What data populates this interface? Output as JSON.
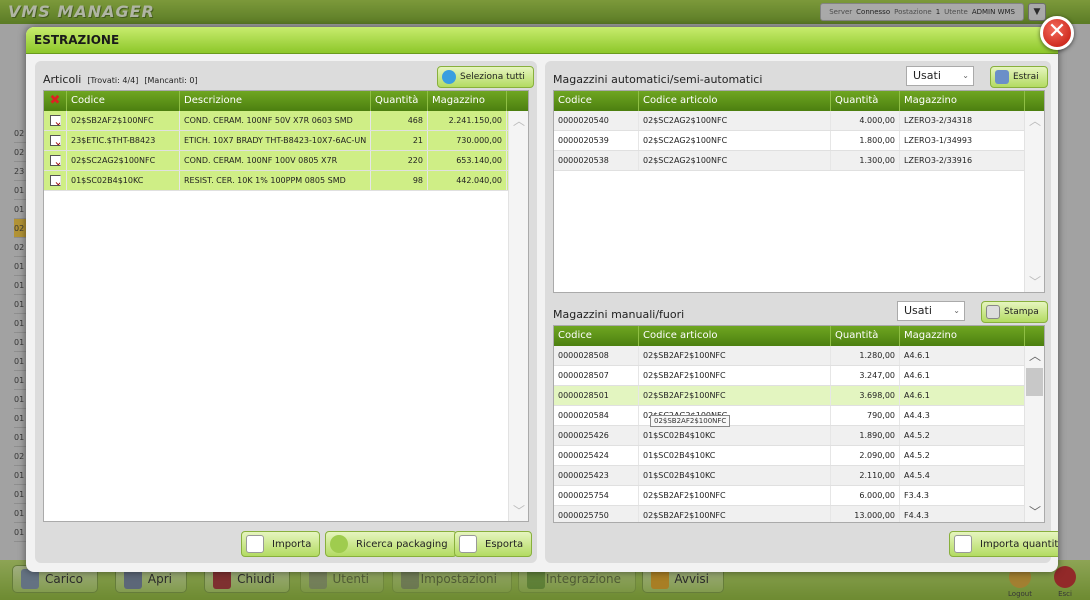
{
  "app": {
    "title": "VMS MANAGER"
  },
  "status": {
    "server_label": "Server",
    "server_value": "Connesso",
    "station_label": "Postazione",
    "station_value": "1",
    "user_label": "Utente",
    "user_value": "ADMIN WMS"
  },
  "background_list": [
    "02",
    "02",
    "23",
    "01",
    "01",
    "02",
    "02",
    "01",
    "01",
    "01",
    "01",
    "01",
    "01",
    "01",
    "01",
    "01",
    "01",
    "02",
    "01",
    "01",
    "01",
    "01"
  ],
  "bottom": {
    "buttons": [
      "Carico",
      "Apri",
      "Chiudi",
      "Utenti",
      "Impostazioni",
      "Integrazione",
      "Avvisi"
    ],
    "logout": "Logout",
    "exit": "Esci"
  },
  "dialog": {
    "title": "ESTRAZIONE",
    "left": {
      "title": "Articoli",
      "found": "[Trovati: 4/4]",
      "missing": "[Mancanti: 0]",
      "select_all": "Seleziona tutti",
      "columns": [
        "Codice",
        "Descrizione",
        "Quantità",
        "Magazzino"
      ],
      "rows": [
        {
          "code": "02$SB2AF2$100NFC",
          "desc": "COND. CERAM. 100NF 50V X7R 0603 SMD",
          "qty": "468",
          "stock": "2.241.150,00"
        },
        {
          "code": "23$ETIC.$THT-B8423",
          "desc": "ETICH. 10X7 BRADY THT-B8423-10X7-6AC-UN",
          "qty": "21",
          "stock": "730.000,00"
        },
        {
          "code": "02$SC2AG2$100NFC",
          "desc": "COND. CERAM. 100NF 100V 0805 X7R",
          "qty": "220",
          "stock": "653.140,00"
        },
        {
          "code": "01$SC02B4$10KC",
          "desc": "RESIST. CER. 10K 1% 100PPM 0805 SMD",
          "qty": "98",
          "stock": "442.040,00"
        }
      ],
      "btn_import": "Importa",
      "btn_packaging": "Ricerca packaging",
      "btn_export": "Esporta"
    },
    "auto": {
      "title": "Magazzini automatici/semi-automatici",
      "filter": "Usati",
      "btn_extract": "Estrai",
      "columns": [
        "Codice",
        "Codice articolo",
        "Quantità",
        "Magazzino"
      ],
      "rows": [
        {
          "code": "0000020540",
          "article": "02$SC2AG2$100NFC",
          "qty": "4.000,00",
          "wh": "LZERO3-2/34318"
        },
        {
          "code": "0000020539",
          "article": "02$SC2AG2$100NFC",
          "qty": "1.800,00",
          "wh": "LZERO3-1/34993"
        },
        {
          "code": "0000020538",
          "article": "02$SC2AG2$100NFC",
          "qty": "1.300,00",
          "wh": "LZERO3-2/33916"
        }
      ]
    },
    "manual": {
      "title": "Magazzini manuali/fuori",
      "filter": "Usati",
      "btn_print": "Stampa",
      "columns": [
        "Codice",
        "Codice articolo",
        "Quantità",
        "Magazzino"
      ],
      "rows": [
        {
          "code": "0000028508",
          "article": "02$SB2AF2$100NFC",
          "qty": "1.280,00",
          "wh": "A4.6.1"
        },
        {
          "code": "0000028507",
          "article": "02$SB2AF2$100NFC",
          "qty": "3.247,00",
          "wh": "A4.6.1"
        },
        {
          "code": "0000028501",
          "article": "02$SB2AF2$100NFC",
          "qty": "3.698,00",
          "wh": "A4.6.1"
        },
        {
          "code": "0000020584",
          "article": "02$SC2AG2$100NFC",
          "qty": "790,00",
          "wh": "A4.4.3"
        },
        {
          "code": "0000025426",
          "article": "01$SC02B4$10KC",
          "qty": "1.890,00",
          "wh": "A4.5.2"
        },
        {
          "code": "0000025424",
          "article": "01$SC02B4$10KC",
          "qty": "2.090,00",
          "wh": "A4.5.2"
        },
        {
          "code": "0000025423",
          "article": "01$SC02B4$10KC",
          "qty": "2.110,00",
          "wh": "A4.5.4"
        },
        {
          "code": "0000025754",
          "article": "02$SB2AF2$100NFC",
          "qty": "6.000,00",
          "wh": "F3.4.3"
        },
        {
          "code": "0000025750",
          "article": "02$SB2AF2$100NFC",
          "qty": "13.000,00",
          "wh": "F4.4.3"
        }
      ],
      "tooltip": "02$SB2AF2$100NFC",
      "btn_import_qty": "Importa quantità"
    }
  },
  "colors": {
    "accent": "#8dc72a",
    "header": "#5a8f16",
    "selected_row": "#cfee86",
    "close": "#d8231a"
  }
}
